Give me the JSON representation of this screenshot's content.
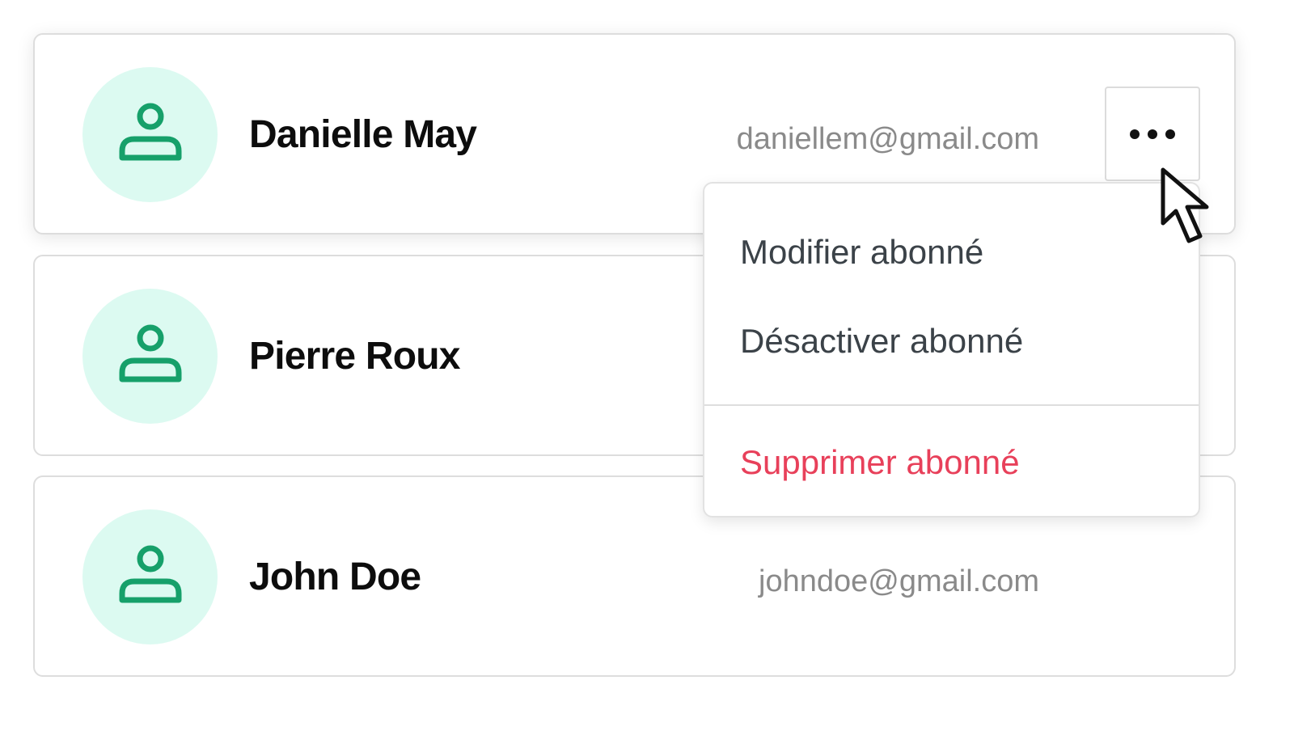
{
  "subscribers": [
    {
      "name": "Danielle May",
      "email": "daniellem@gmail.com"
    },
    {
      "name": "Pierre Roux",
      "email": ""
    },
    {
      "name": "John Doe",
      "email": "johndoe@gmail.com"
    }
  ],
  "row_menu": {
    "trigger_icon": "more-horizontal-icon",
    "items": [
      {
        "label": "Modifier abonné"
      },
      {
        "label": "Désactiver abonné"
      },
      {
        "label": "Supprimer abonné"
      }
    ]
  },
  "icons": {
    "avatar": "user-icon",
    "pointer": "mouse-pointer-icon"
  },
  "colors": {
    "avatar_background": "#dcfaf1",
    "avatar_icon": "#16a06a",
    "name_text": "#0d0d0d",
    "email_text": "#8a8a8a",
    "menu_text": "#3b4248",
    "danger_text": "#e8405a"
  }
}
